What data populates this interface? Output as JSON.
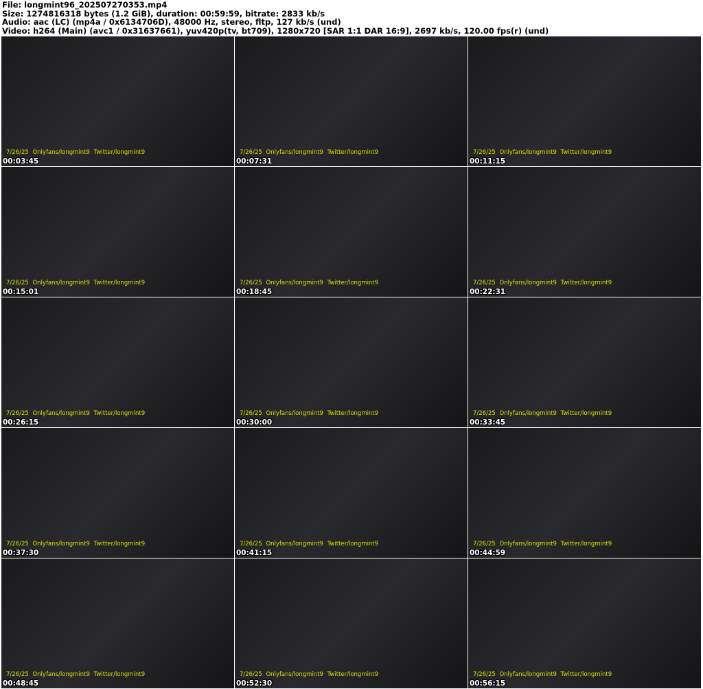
{
  "header": {
    "file": "File: longmint96_202507270353.mp4",
    "size": "Size: 1274816318 bytes (1.2 GiB), duration: 00:59:59, bitrate: 2833 kb/s",
    "audio": "Audio: aac (LC) (mp4a / 0x6134706D), 48000 Hz, stereo, fltp, 127 kb/s (und)",
    "video": "Video: h264 (Main) (avc1 / 0x31637661), yuv420p(tv, bt709), 1280x720 [SAR 1:1 DAR 16:9], 2697 kb/s, 120.00 fps(r) (und)"
  },
  "watermark": "7/26/25  Onlyfans/longmint9  Twitter/longmint9",
  "frames": [
    {
      "timestamp": "00:03:45"
    },
    {
      "timestamp": "00:07:31"
    },
    {
      "timestamp": "00:11:15"
    },
    {
      "timestamp": "00:15:01"
    },
    {
      "timestamp": "00:18:45"
    },
    {
      "timestamp": "00:22:31"
    },
    {
      "timestamp": "00:26:15"
    },
    {
      "timestamp": "00:30:00"
    },
    {
      "timestamp": "00:33:45"
    },
    {
      "timestamp": "00:37:30"
    },
    {
      "timestamp": "00:41:15"
    },
    {
      "timestamp": "00:44:59"
    },
    {
      "timestamp": "00:48:45"
    },
    {
      "timestamp": "00:52:30"
    },
    {
      "timestamp": "00:56:15"
    }
  ]
}
